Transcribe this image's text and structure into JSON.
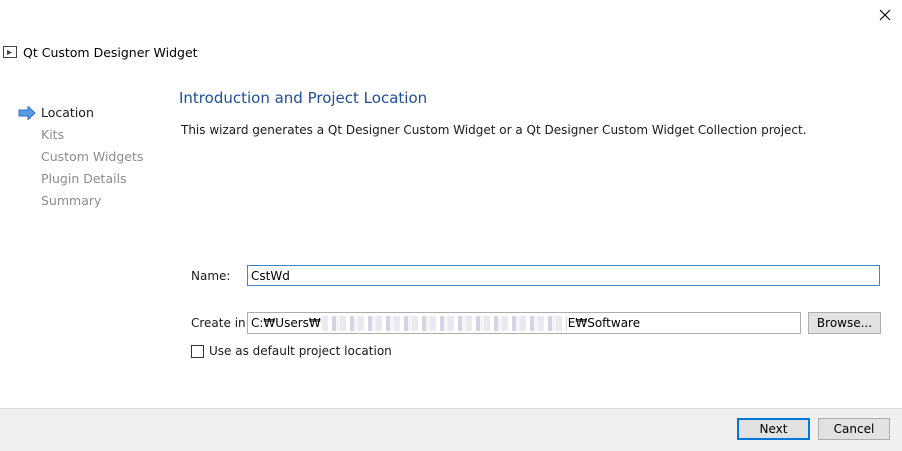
{
  "window": {
    "title": "Qt Custom Designer Widget",
    "close_icon": "close-icon",
    "app_icon": "window-icon"
  },
  "steps": [
    {
      "label": "Location",
      "active": true
    },
    {
      "label": "Kits",
      "active": false
    },
    {
      "label": "Custom Widgets",
      "active": false
    },
    {
      "label": "Plugin Details",
      "active": false
    },
    {
      "label": "Summary",
      "active": false
    }
  ],
  "page": {
    "heading": "Introduction and Project Location",
    "description": "This wizard generates a Qt Designer Custom Widget or a Qt Designer Custom Widget Collection project."
  },
  "form": {
    "name_label": "Name:",
    "name_value": "CstWd",
    "create_in_label": "Create in:",
    "create_in_prefix": "C:₩Users₩",
    "create_in_suffix": "E₩Software",
    "browse_label": "Browse...",
    "default_location_label": "Use as default project location",
    "default_location_checked": false
  },
  "footer": {
    "next_label": "Next",
    "cancel_label": "Cancel"
  },
  "colors": {
    "heading": "#1e4e9c",
    "active_arrow": "#3a7bd5",
    "inactive_step": "#8c8c8c",
    "focus_border": "#3a86d0"
  }
}
